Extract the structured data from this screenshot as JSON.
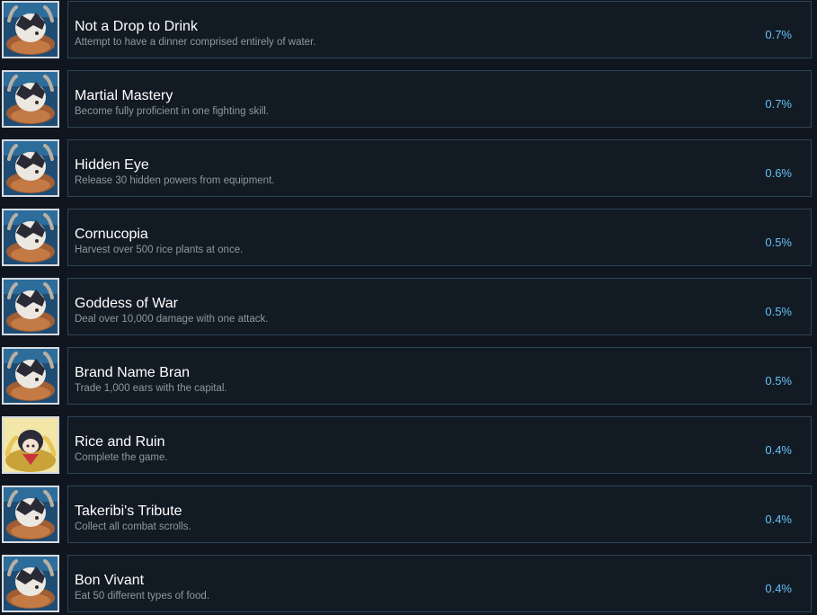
{
  "achievements": [
    {
      "title": "Not a Drop to Drink",
      "description": "Attempt to have a dinner comprised entirely of water.",
      "percent": "0.7%",
      "icon": "silver-rice-badge-icon"
    },
    {
      "title": "Martial Mastery",
      "description": "Become fully proficient in one fighting skill.",
      "percent": "0.7%",
      "icon": "silver-rice-badge-icon"
    },
    {
      "title": "Hidden Eye",
      "description": "Release 30 hidden powers from equipment.",
      "percent": "0.6%",
      "icon": "silver-rice-badge-icon"
    },
    {
      "title": "Cornucopia",
      "description": "Harvest over 500 rice plants at once.",
      "percent": "0.5%",
      "icon": "silver-rice-badge-icon"
    },
    {
      "title": "Goddess of War",
      "description": "Deal over 10,000 damage with one attack.",
      "percent": "0.5%",
      "icon": "silver-rice-badge-icon"
    },
    {
      "title": "Brand Name Bran",
      "description": "Trade 1,000 ears with the capital.",
      "percent": "0.5%",
      "icon": "silver-rice-badge-icon"
    },
    {
      "title": "Rice and Ruin",
      "description": "Complete the game.",
      "percent": "0.4%",
      "icon": "gold-sakuna-badge-icon"
    },
    {
      "title": "Takeribi's Tribute",
      "description": "Collect all combat scrolls.",
      "percent": "0.4%",
      "icon": "silver-rice-badge-icon"
    },
    {
      "title": "Bon Vivant",
      "description": "Eat 50 different types of food.",
      "percent": "0.4%",
      "icon": "silver-rice-badge-icon"
    }
  ],
  "colors": {
    "background": "#10161f",
    "card": "#121a24",
    "card_border": "#2c4558",
    "title": "#ffffff",
    "description": "#8f98a0",
    "percent": "#67c1f5",
    "icon_bg": "#1f4c73",
    "icon_gold_bg": "#f2e6a8"
  }
}
